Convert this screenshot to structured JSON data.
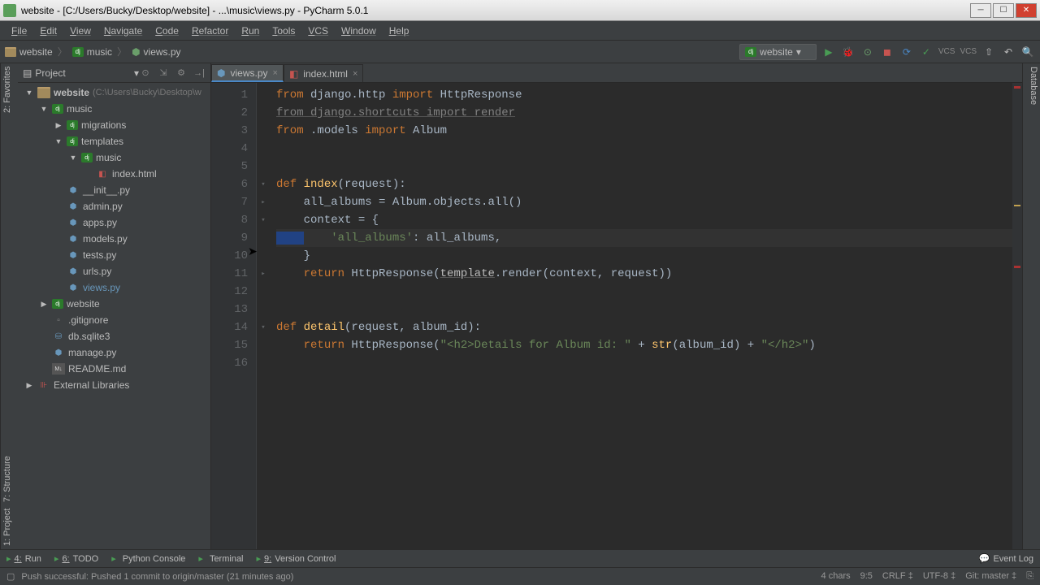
{
  "window": {
    "title": "website - [C:/Users/Bucky/Desktop/website] - ...\\music\\views.py - PyCharm 5.0.1"
  },
  "menu": [
    "File",
    "Edit",
    "View",
    "Navigate",
    "Code",
    "Refactor",
    "Run",
    "Tools",
    "VCS",
    "Window",
    "Help"
  ],
  "breadcrumb": [
    {
      "label": "website",
      "icon": "folder"
    },
    {
      "label": "music",
      "icon": "dj"
    },
    {
      "label": "views.py",
      "icon": "py"
    }
  ],
  "run_config": "website",
  "project_panel": {
    "title": "Project"
  },
  "tree": {
    "root": {
      "name": "website",
      "path": "(C:\\Users\\Bucky\\Desktop\\w"
    },
    "items": [
      {
        "depth": 1,
        "arrow": "▼",
        "icon": "dj",
        "label": "music"
      },
      {
        "depth": 2,
        "arrow": "▶",
        "icon": "dj",
        "label": "migrations"
      },
      {
        "depth": 2,
        "arrow": "▼",
        "icon": "dj",
        "label": "templates"
      },
      {
        "depth": 3,
        "arrow": "▼",
        "icon": "dj",
        "label": "music"
      },
      {
        "depth": 4,
        "arrow": "",
        "icon": "html",
        "label": "index.html"
      },
      {
        "depth": 2,
        "arrow": "",
        "icon": "py",
        "label": "__init__.py"
      },
      {
        "depth": 2,
        "arrow": "",
        "icon": "py",
        "label": "admin.py"
      },
      {
        "depth": 2,
        "arrow": "",
        "icon": "py",
        "label": "apps.py"
      },
      {
        "depth": 2,
        "arrow": "",
        "icon": "py",
        "label": "models.py"
      },
      {
        "depth": 2,
        "arrow": "",
        "icon": "py",
        "label": "tests.py"
      },
      {
        "depth": 2,
        "arrow": "",
        "icon": "py",
        "label": "urls.py"
      },
      {
        "depth": 2,
        "arrow": "",
        "icon": "py",
        "label": "views.py",
        "highlight": true
      },
      {
        "depth": 1,
        "arrow": "▶",
        "icon": "dj",
        "label": "website"
      },
      {
        "depth": 1,
        "arrow": "",
        "icon": "txt",
        "label": ".gitignore"
      },
      {
        "depth": 1,
        "arrow": "",
        "icon": "db",
        "label": "db.sqlite3"
      },
      {
        "depth": 1,
        "arrow": "",
        "icon": "py",
        "label": "manage.py"
      },
      {
        "depth": 1,
        "arrow": "",
        "icon": "md",
        "label": "README.md"
      }
    ],
    "ext_libs": "External Libraries"
  },
  "tabs": [
    {
      "label": "views.py",
      "icon": "py",
      "active": true
    },
    {
      "label": "index.html",
      "icon": "html",
      "active": false
    }
  ],
  "code": {
    "lines": [
      {
        "n": 1,
        "tokens": [
          [
            "kw",
            "from"
          ],
          [
            "ident",
            " django.http "
          ],
          [
            "kw",
            "import"
          ],
          [
            "ident",
            " HttpResponse"
          ]
        ]
      },
      {
        "n": 2,
        "tokens": [
          [
            "gray underline",
            "from django.shortcuts import render"
          ]
        ]
      },
      {
        "n": 3,
        "tokens": [
          [
            "kw",
            "from"
          ],
          [
            "ident",
            " .models "
          ],
          [
            "kw",
            "import"
          ],
          [
            "ident",
            " Album"
          ]
        ]
      },
      {
        "n": 4,
        "tokens": []
      },
      {
        "n": 5,
        "tokens": []
      },
      {
        "n": 6,
        "tokens": [
          [
            "kw",
            "def "
          ],
          [
            "fn",
            "index"
          ],
          [
            "ident",
            "(request):"
          ]
        ]
      },
      {
        "n": 7,
        "tokens": [
          [
            "ident",
            "    all_albums = Album.objects.all()"
          ]
        ]
      },
      {
        "n": 8,
        "tokens": [
          [
            "ident",
            "    context = {"
          ]
        ]
      },
      {
        "n": 9,
        "current": true,
        "tokens": [
          [
            "selection",
            "    "
          ],
          [
            "ident",
            "    "
          ],
          [
            "str",
            "'all_albums'"
          ],
          [
            "ident",
            ": all_albums,"
          ]
        ]
      },
      {
        "n": 10,
        "tokens": [
          [
            "ident",
            "    }"
          ]
        ]
      },
      {
        "n": 11,
        "tokens": [
          [
            "ident",
            "    "
          ],
          [
            "kw",
            "return"
          ],
          [
            "ident",
            " HttpResponse("
          ],
          [
            "underline",
            "template"
          ],
          [
            "ident",
            ".render(context, request))"
          ]
        ]
      },
      {
        "n": 12,
        "tokens": []
      },
      {
        "n": 13,
        "tokens": []
      },
      {
        "n": 14,
        "tokens": [
          [
            "kw",
            "def "
          ],
          [
            "fn",
            "detail"
          ],
          [
            "ident",
            "(request, album_id):"
          ]
        ]
      },
      {
        "n": 15,
        "tokens": [
          [
            "ident",
            "    "
          ],
          [
            "kw",
            "return"
          ],
          [
            "ident",
            " HttpResponse("
          ],
          [
            "str",
            "\"<h2>Details for Album id: \""
          ],
          [
            "ident",
            " + "
          ],
          [
            "fn",
            "str"
          ],
          [
            "ident",
            "(album_id) + "
          ],
          [
            "str",
            "\"</h2>\""
          ],
          [
            "ident",
            ")"
          ]
        ]
      },
      {
        "n": 16,
        "tokens": []
      }
    ]
  },
  "left_gutter": [
    "1: Project",
    "7: Structure"
  ],
  "left_gutter_bottom": "2: Favorites",
  "right_gutter": "Database",
  "tool_bar": {
    "items": [
      {
        "num": "4:",
        "label": "Run"
      },
      {
        "num": "6:",
        "label": "TODO"
      },
      {
        "num": "",
        "label": "Python Console"
      },
      {
        "num": "",
        "label": "Terminal"
      },
      {
        "num": "9:",
        "label": "Version Control"
      }
    ],
    "right": "Event Log"
  },
  "status": {
    "message": "Push successful: Pushed 1 commit to origin/master (21 minutes ago)",
    "chars": "4 chars",
    "pos": "9:5",
    "crlf": "CRLF",
    "encoding": "UTF-8",
    "git": "Git: master",
    "lock": "⎘"
  }
}
